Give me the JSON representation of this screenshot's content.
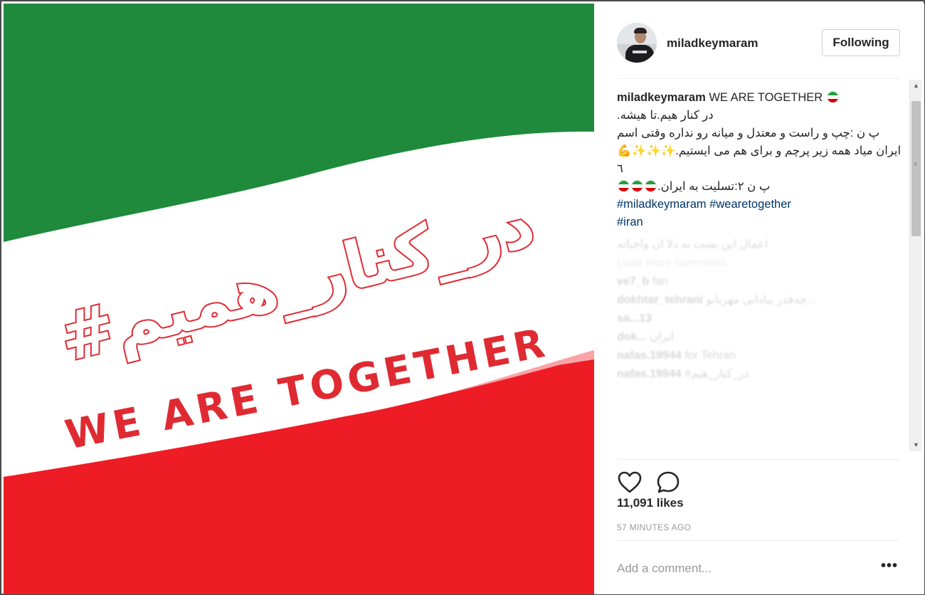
{
  "media": {
    "hashtag_fa": "#در_کنار_همیم",
    "headline_en": "WE ARE TOGETHER",
    "colors": {
      "green": "#1f8a3b",
      "white": "#ffffff",
      "red": "#ee1c25",
      "text_red": "#e02a32"
    }
  },
  "header": {
    "username": "miladkeymaram",
    "follow_label": "Following",
    "avatar_icon": "profile-photo"
  },
  "caption": {
    "username": "miladkeymaram",
    "line1": "WE ARE TOGETHER",
    "line2": "در کنار هیم.تا هیشه.",
    "line3": "پ ن :چپ و راست و معتدل و میانه رو نداره وقتی اسم",
    "line4": "ایران میاد همه زیر پرچم و برای هم می ایستیم.",
    "line4_sparkles": "✨✨✨",
    "line5": "٦",
    "line6": "پ ن ۲:تسلیت به ایران.",
    "hashtags": [
      "#miladkeymaram",
      "#wearetogether",
      "#iran"
    ]
  },
  "faded_comments": {
    "row1": "اعمال این بست به دلا ان واجباته",
    "load_more": "Load more comments",
    "row2_user": "ve7_b",
    "row2_text": "fan",
    "row3_user": "dokhtar_tehrani",
    "row3_text": "چه‌قدر بیادانی مهربانو...",
    "row4_user": "sa...13",
    "row5_user": "dok...",
    "row5_text": "ایران",
    "row6_user": "nafas.19944",
    "row6_text": "for Tehran",
    "row7_user": "nafas.19944",
    "row7_text": "#در_کنار_هیم"
  },
  "scroll": {
    "up_icon": "scroll-up-arrow",
    "down_icon": "scroll-down-arrow",
    "grip": "≡"
  },
  "actions": {
    "like_icon": "heart-icon",
    "comment_icon": "comment-icon"
  },
  "likes": "11,091 likes",
  "timestamp": "57 MINUTES AGO",
  "add_comment": {
    "placeholder": "Add a comment...",
    "more_label": "•••"
  }
}
